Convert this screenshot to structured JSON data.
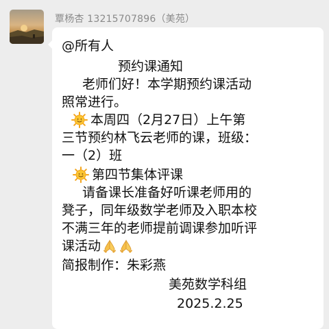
{
  "sender": {
    "name": "覃杨杏 13215707896（美苑）"
  },
  "message": {
    "mention": "@所有人",
    "title": "预约课通知",
    "greeting_1": "老师们好！本学期预约课活动",
    "greeting_2": "照常进行。",
    "item1_line1": "本周四（2月27日）上午第",
    "item1_line2": "三节预约林飞云老师的课，班级：",
    "item1_line3": "一（2）班",
    "item2_heading": "第四节集体评课",
    "item2_line1": "请备课长准备好听课老师用的",
    "item2_line2": "凳子，同年级数学老师及入职本校",
    "item2_line3": "不满三年的老师提前调课参加听评",
    "item2_line4": "课活动",
    "reporter": "简报制作：朱彩燕",
    "signature": "美苑数学科组",
    "date": "2025.2.25"
  },
  "icons": {
    "bullet_icon": "sun-emoji-icon",
    "reaction_icon": "folded-hands-emoji-icon"
  },
  "colors": {
    "chat_background": "#ededed",
    "bubble_background": "#ffffff",
    "sender_name": "#8a8a8a",
    "text": "#111111"
  }
}
